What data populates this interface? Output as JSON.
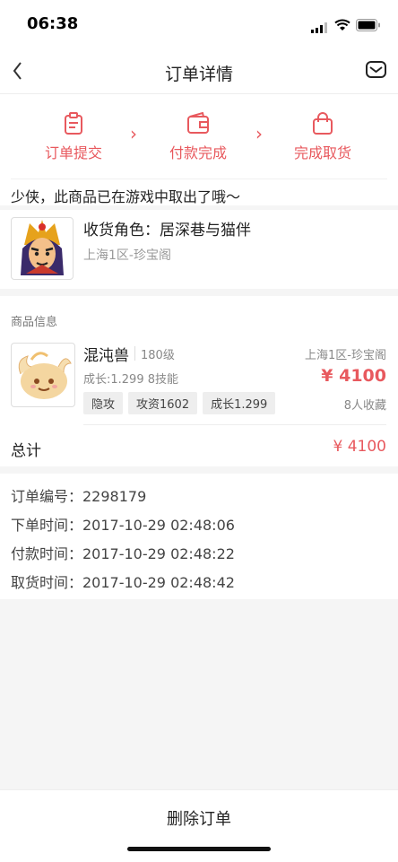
{
  "status": {
    "time": "06:38"
  },
  "nav": {
    "title": "订单详情"
  },
  "steps": [
    {
      "label": "订单提交",
      "icon": "clipboard-icon"
    },
    {
      "label": "付款完成",
      "icon": "wallet-icon"
    },
    {
      "label": "完成取货",
      "icon": "bag-icon"
    }
  ],
  "notice": "少侠，此商品已在游戏中取出了哦～",
  "role": {
    "title": "收货角色：居深巷与猫伴",
    "server": "上海1区-珍宝阁"
  },
  "goods": {
    "section_title": "商品信息",
    "name": "混沌兽",
    "level": "180级",
    "server": "上海1区-珍宝阁",
    "growth_skills": "成长:1.299 8技能",
    "price": "¥ 4100",
    "favorites": "8人收藏",
    "tags": [
      "隐攻",
      "攻资1602",
      "成长1.299"
    ],
    "total_label": "总计",
    "total_value": "¥ 4100"
  },
  "order": {
    "number": "订单编号：2298179",
    "order_time": "下单时间：2017-10-29 02:48:06",
    "pay_time": "付款时间：2017-10-29 02:48:22",
    "pickup_time": "取货时间：2017-10-29 02:48:42"
  },
  "bottom": {
    "delete_label": "删除订单"
  },
  "colors": {
    "accent": "#e8595e"
  }
}
